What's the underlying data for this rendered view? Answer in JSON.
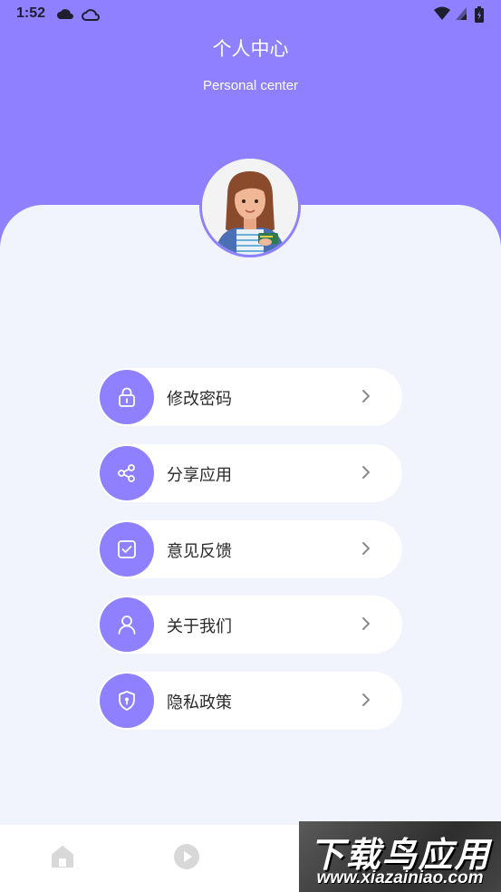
{
  "status_bar": {
    "time": "1:52",
    "icons": [
      "cloud-icon",
      "cloud-outline-icon",
      "wifi-icon",
      "signal-icon",
      "battery-icon"
    ]
  },
  "header": {
    "title": "个人中心",
    "subtitle": "Personal center"
  },
  "menu": [
    {
      "label": "修改密码",
      "icon": "lock-icon"
    },
    {
      "label": "分享应用",
      "icon": "share-icon"
    },
    {
      "label": "意见反馈",
      "icon": "feedback-icon"
    },
    {
      "label": "关于我们",
      "icon": "user-icon"
    },
    {
      "label": "隐私政策",
      "icon": "shield-icon"
    }
  ],
  "bottom_nav": {
    "items": [
      "home-icon",
      "play-icon",
      "profile-icon"
    ]
  },
  "watermark": {
    "main": "下载鸟应用",
    "sub": "www.xiazainiao.com"
  },
  "colors": {
    "accent": "#8e80ff",
    "background": "#f2f4fd",
    "card": "#ffffff"
  }
}
